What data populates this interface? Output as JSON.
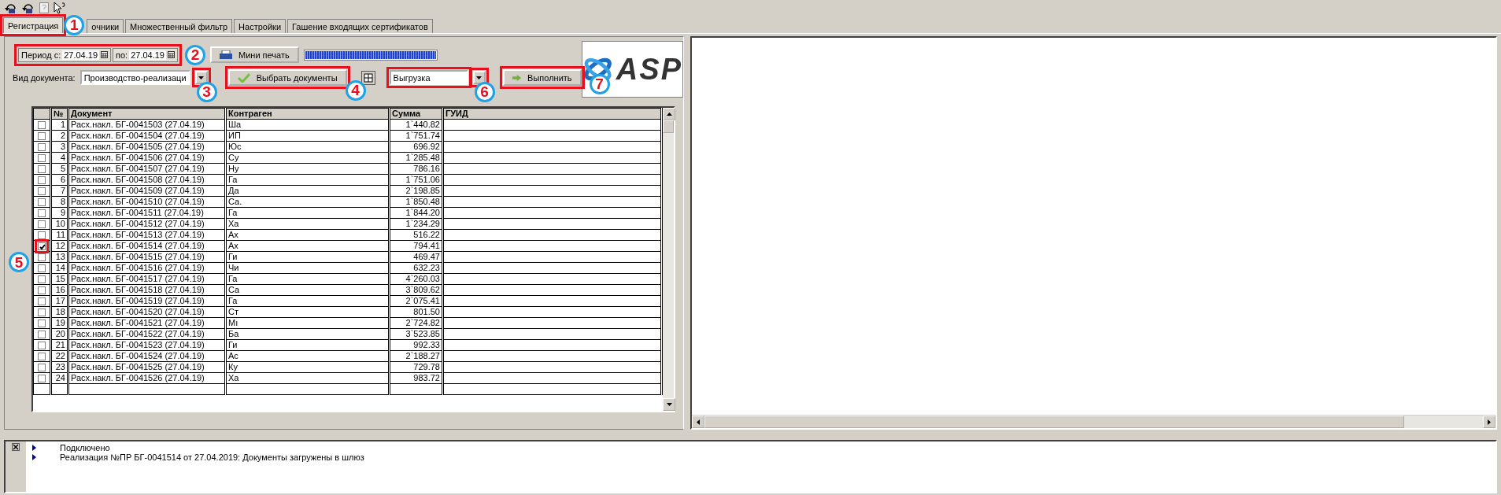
{
  "tabs": [
    {
      "label": "Регистрация",
      "selected": true,
      "callout": "1"
    },
    {
      "label": "очники",
      "selected": false
    },
    {
      "label": "Множественный фильтр",
      "selected": false
    },
    {
      "label": "Настройки",
      "selected": false
    },
    {
      "label": "Гашение входящих сертификатов",
      "selected": false
    }
  ],
  "period": {
    "from_label": "Период с:",
    "from": "27.04.19",
    "to_label": "по:",
    "to": "27.04.19",
    "callout": "2"
  },
  "mini_print": {
    "label": "Мини печать"
  },
  "progress": {
    "level": 1
  },
  "doc_type": {
    "label": "Вид документа:",
    "value": "Производство-реализаци",
    "callout": "3"
  },
  "select_button": {
    "label": "Выбрать документы",
    "callout": "4"
  },
  "action": {
    "value": "Выгрузка",
    "callout": "6"
  },
  "run_button": {
    "label": "Выполнить",
    "callout": "7"
  },
  "logo": {
    "text": "ASP"
  },
  "table": {
    "columns": [
      "№",
      "Документ",
      "Контраген",
      "Сумма",
      "ГУИД"
    ],
    "rows": [
      {
        "checked": false,
        "num": "1",
        "doc": "Расх.накл. БГ-0041503 (27.04.19)",
        "party": "Ша",
        "sum": "1`440.82"
      },
      {
        "checked": false,
        "num": "2",
        "doc": "Расх.накл. БГ-0041504 (27.04.19)",
        "party": "ИП",
        "sum": "1`751.74"
      },
      {
        "checked": false,
        "num": "3",
        "doc": "Расх.накл. БГ-0041505 (27.04.19)",
        "party": "Юс",
        "sum": "696.92"
      },
      {
        "checked": false,
        "num": "4",
        "doc": "Расх.накл. БГ-0041506 (27.04.19)",
        "party": "Су",
        "sum": "1`285.48"
      },
      {
        "checked": false,
        "num": "5",
        "doc": "Расх.накл. БГ-0041507 (27.04.19)",
        "party": "Ну",
        "sum": "786.16"
      },
      {
        "checked": false,
        "num": "6",
        "doc": "Расх.накл. БГ-0041508 (27.04.19)",
        "party": "Га",
        "sum": "1`751.06"
      },
      {
        "checked": false,
        "num": "7",
        "doc": "Расх.накл. БГ-0041509 (27.04.19)",
        "party": "Да",
        "sum": "2`198.85"
      },
      {
        "checked": false,
        "num": "8",
        "doc": "Расх.накл. БГ-0041510 (27.04.19)",
        "party": "Са.",
        "sum": "1`850.48"
      },
      {
        "checked": false,
        "num": "9",
        "doc": "Расх.накл. БГ-0041511 (27.04.19)",
        "party": "Га",
        "sum": "1`844.20"
      },
      {
        "checked": false,
        "num": "10",
        "doc": "Расх.накл. БГ-0041512 (27.04.19)",
        "party": "Ха",
        "sum": "1`234.29"
      },
      {
        "checked": false,
        "num": "11",
        "doc": "Расх.накл. БГ-0041513 (27.04.19)",
        "party": "Ах",
        "sum": "516.22"
      },
      {
        "checked": true,
        "num": "12",
        "doc": "Расх.накл. БГ-0041514 (27.04.19)",
        "party": "Ах",
        "sum": "794.41",
        "callout": "5"
      },
      {
        "checked": false,
        "num": "13",
        "doc": "Расх.накл. БГ-0041515 (27.04.19)",
        "party": "Ги",
        "sum": "469.47"
      },
      {
        "checked": false,
        "num": "14",
        "doc": "Расх.накл. БГ-0041516 (27.04.19)",
        "party": "Чи",
        "sum": "632.23"
      },
      {
        "checked": false,
        "num": "15",
        "doc": "Расх.накл. БГ-0041517 (27.04.19)",
        "party": "Га",
        "sum": "4`260.03"
      },
      {
        "checked": false,
        "num": "16",
        "doc": "Расх.накл. БГ-0041518 (27.04.19)",
        "party": "Са",
        "sum": "3`809.62"
      },
      {
        "checked": false,
        "num": "17",
        "doc": "Расх.накл. БГ-0041519 (27.04.19)",
        "party": "Га",
        "sum": "2`075.41"
      },
      {
        "checked": false,
        "num": "18",
        "doc": "Расх.накл. БГ-0041520 (27.04.19)",
        "party": "Ст",
        "sum": "801.50"
      },
      {
        "checked": false,
        "num": "19",
        "doc": "Расх.накл. БГ-0041521 (27.04.19)",
        "party": "Мı",
        "sum": "2`724.82"
      },
      {
        "checked": false,
        "num": "20",
        "doc": "Расх.накл. БГ-0041522 (27.04.19)",
        "party": "Ба",
        "sum": "3`523.85"
      },
      {
        "checked": false,
        "num": "21",
        "doc": "Расх.накл. БГ-0041523 (27.04.19)",
        "party": "Ги",
        "sum": "992.33"
      },
      {
        "checked": false,
        "num": "22",
        "doc": "Расх.накл. БГ-0041524 (27.04.19)",
        "party": "Ас",
        "sum": "2`188.27"
      },
      {
        "checked": false,
        "num": "23",
        "doc": "Расх.накл. БГ-0041525 (27.04.19)",
        "party": "Ку",
        "sum": "729.78"
      },
      {
        "checked": false,
        "num": "24",
        "doc": "Расх.накл. БГ-0041526 (27.04.19)",
        "party": "Ха",
        "sum": "983.72"
      }
    ]
  },
  "log": [
    "Подключено",
    "Реализация №ПР  БГ-0041514 от 27.04.2019: Документы загружены в шлюз"
  ]
}
